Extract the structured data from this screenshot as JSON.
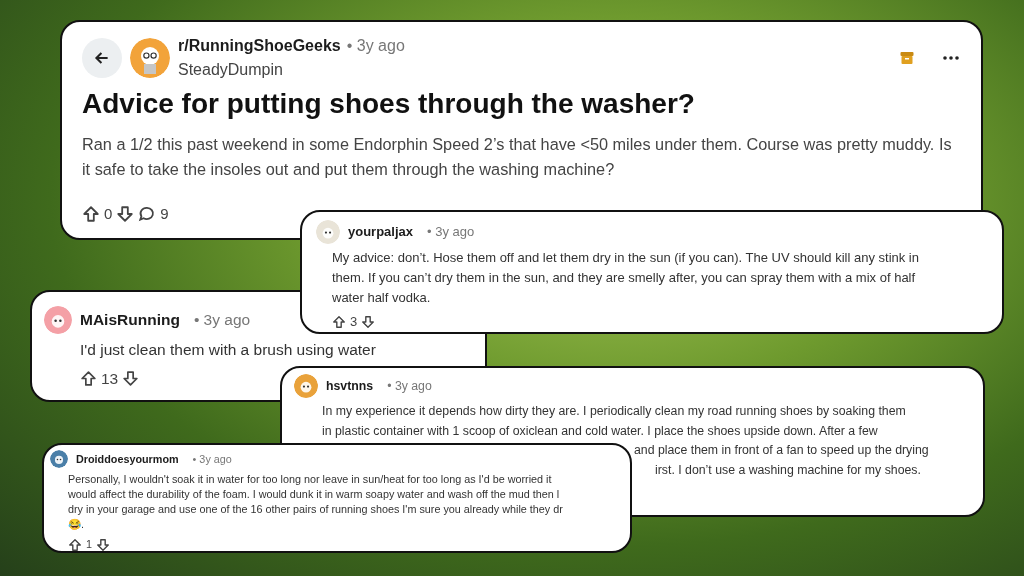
{
  "post": {
    "subreddit": "r/RunningShoeGeeks",
    "time": "• 3y ago",
    "author": "SteadyDumpin",
    "title": "Advice for putting shoes through the washer?",
    "body": "Ran a 1/2 this past weekend in some Endorphin Speed 2’s that have <50 miles under them. Course was pretty muddy. Is it safe to take the insoles out and put them through the washing machine?",
    "score": "0",
    "comments": "9"
  },
  "comments": [
    {
      "user": "yourpaljax",
      "time": "• 3y ago",
      "lines": [
        "My advice: don’t. Hose them off and let them dry in the sun (if you can). The UV should kill any stink in",
        "them. If you can’t dry them in the sun, and they are smelly after, you can spray them with a mix of half",
        "water half vodka."
      ],
      "score": "3"
    },
    {
      "user": "MAisRunning",
      "time": "• 3y ago",
      "lines": [
        "I'd just clean them with a brush using water"
      ],
      "score": "13"
    },
    {
      "user": "hsvtnns",
      "time": "• 3y ago",
      "lines": [
        "In my experience it depends how dirty they are. I periodically clean my road running shoes by soaking them",
        "in plastic container with 1 scoop of oxiclean and cold water. I place the shoes upside down. After a few",
        "and place them in front of a fan to speed up the drying",
        "irst. I don’t use a washing machine for my shoes."
      ]
    },
    {
      "user": "Droiddoesyourmom",
      "time": "• 3y ago",
      "lines": [
        "Personally, I wouldn't soak it in water for too long nor leave in sun/heat for too long as I'd be worried it",
        "would affect the durability of the foam. I would dunk it in warm soapy water and wash off the mud then l",
        "dry in your garage and use one of the 16 other pairs of running shoes I'm sure you already while they dr",
        "😂."
      ],
      "score": "1"
    }
  ]
}
